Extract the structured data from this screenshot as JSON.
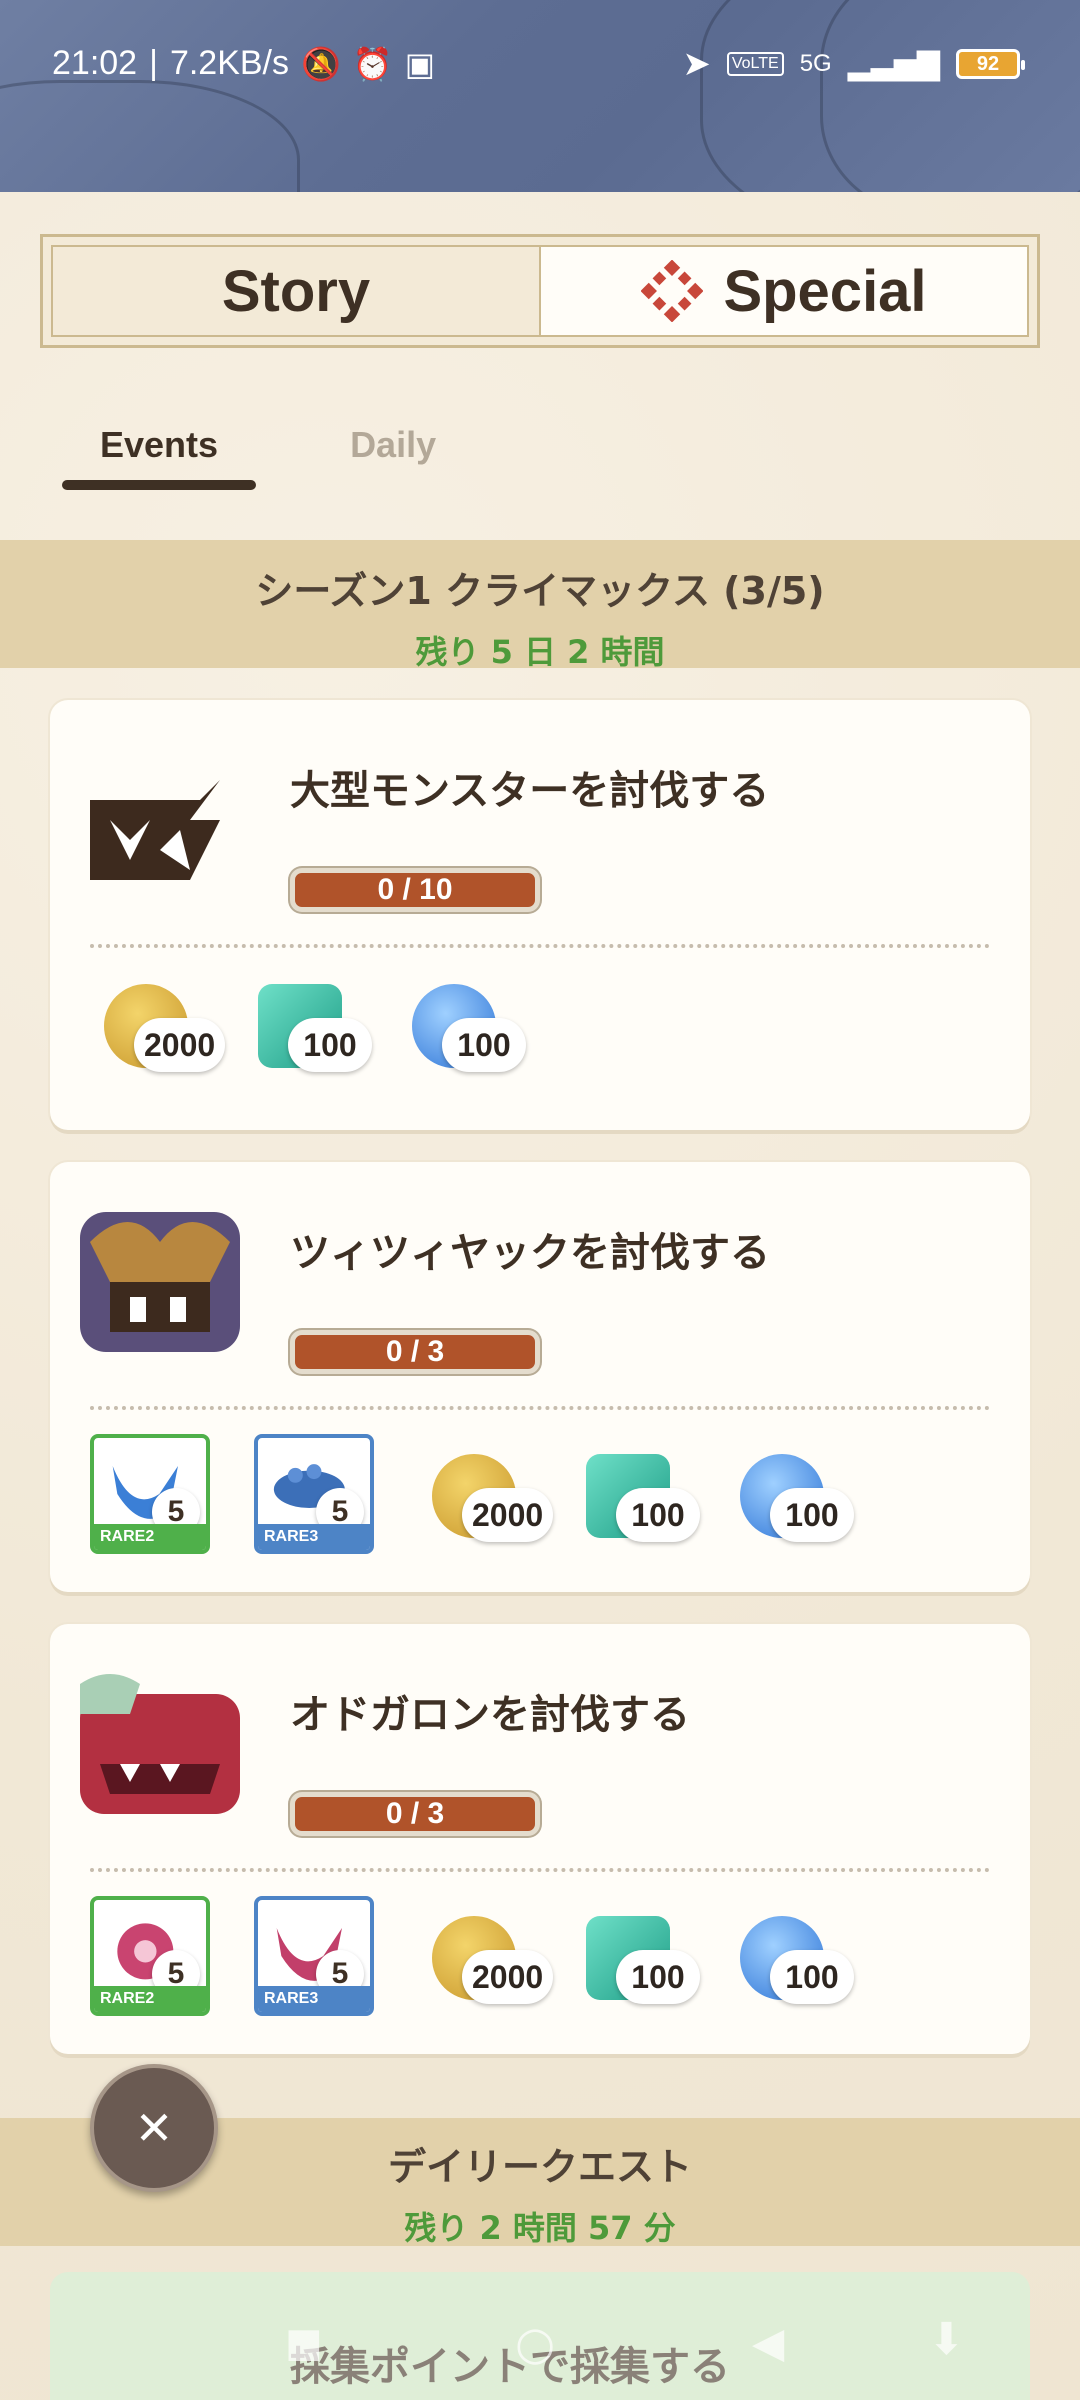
{
  "status_bar": {
    "time": "21:02",
    "separator": "|",
    "network_speed": "7.2KB/s",
    "battery_level": "92",
    "network_type": "5G",
    "volte": "VoLTE"
  },
  "top_tabs": {
    "story_label": "Story",
    "special_label": "Special",
    "active": "special"
  },
  "sub_tabs": {
    "events_label": "Events",
    "daily_label": "Daily",
    "active": "events"
  },
  "season_section": {
    "title": "シーズン1 クライマックス (3/5)",
    "remaining": "残り 5 日 2 時間"
  },
  "quests": [
    {
      "title": "大型モンスターを討伐する",
      "progress": "0 / 10",
      "progress_fraction": 0,
      "rewards": [
        {
          "type": "zenny",
          "count": "2000"
        },
        {
          "type": "gem",
          "count": "100"
        },
        {
          "type": "special-point",
          "count": "100"
        }
      ]
    },
    {
      "title": "ツィツィヤックを討伐する",
      "progress": "0 / 3",
      "progress_fraction": 0,
      "items": [
        {
          "rarity": "RARE2",
          "count": "5"
        },
        {
          "rarity": "RARE3",
          "count": "5"
        }
      ],
      "rewards": [
        {
          "type": "zenny",
          "count": "2000"
        },
        {
          "type": "gem",
          "count": "100"
        },
        {
          "type": "special-point",
          "count": "100"
        }
      ]
    },
    {
      "title": "オドガロンを討伐する",
      "progress": "0 / 3",
      "progress_fraction": 0,
      "items": [
        {
          "rarity": "RARE2",
          "count": "5"
        },
        {
          "rarity": "RARE3",
          "count": "5"
        }
      ],
      "rewards": [
        {
          "type": "zenny",
          "count": "2000"
        },
        {
          "type": "gem",
          "count": "100"
        },
        {
          "type": "special-point",
          "count": "100"
        }
      ]
    }
  ],
  "daily_section": {
    "title": "デイリークエスト",
    "remaining": "残り 2 時間 57 分"
  },
  "bottom_quest": {
    "title": "採集ポイントで採集する"
  },
  "close_button_icon": "close-icon",
  "colors": {
    "progress_bar": "#b0532a",
    "remaining_text": "#4e9a3a",
    "banner_bg": "#e2d1aa",
    "rare2": "#4fb04a",
    "rare3": "#4d84c6"
  }
}
